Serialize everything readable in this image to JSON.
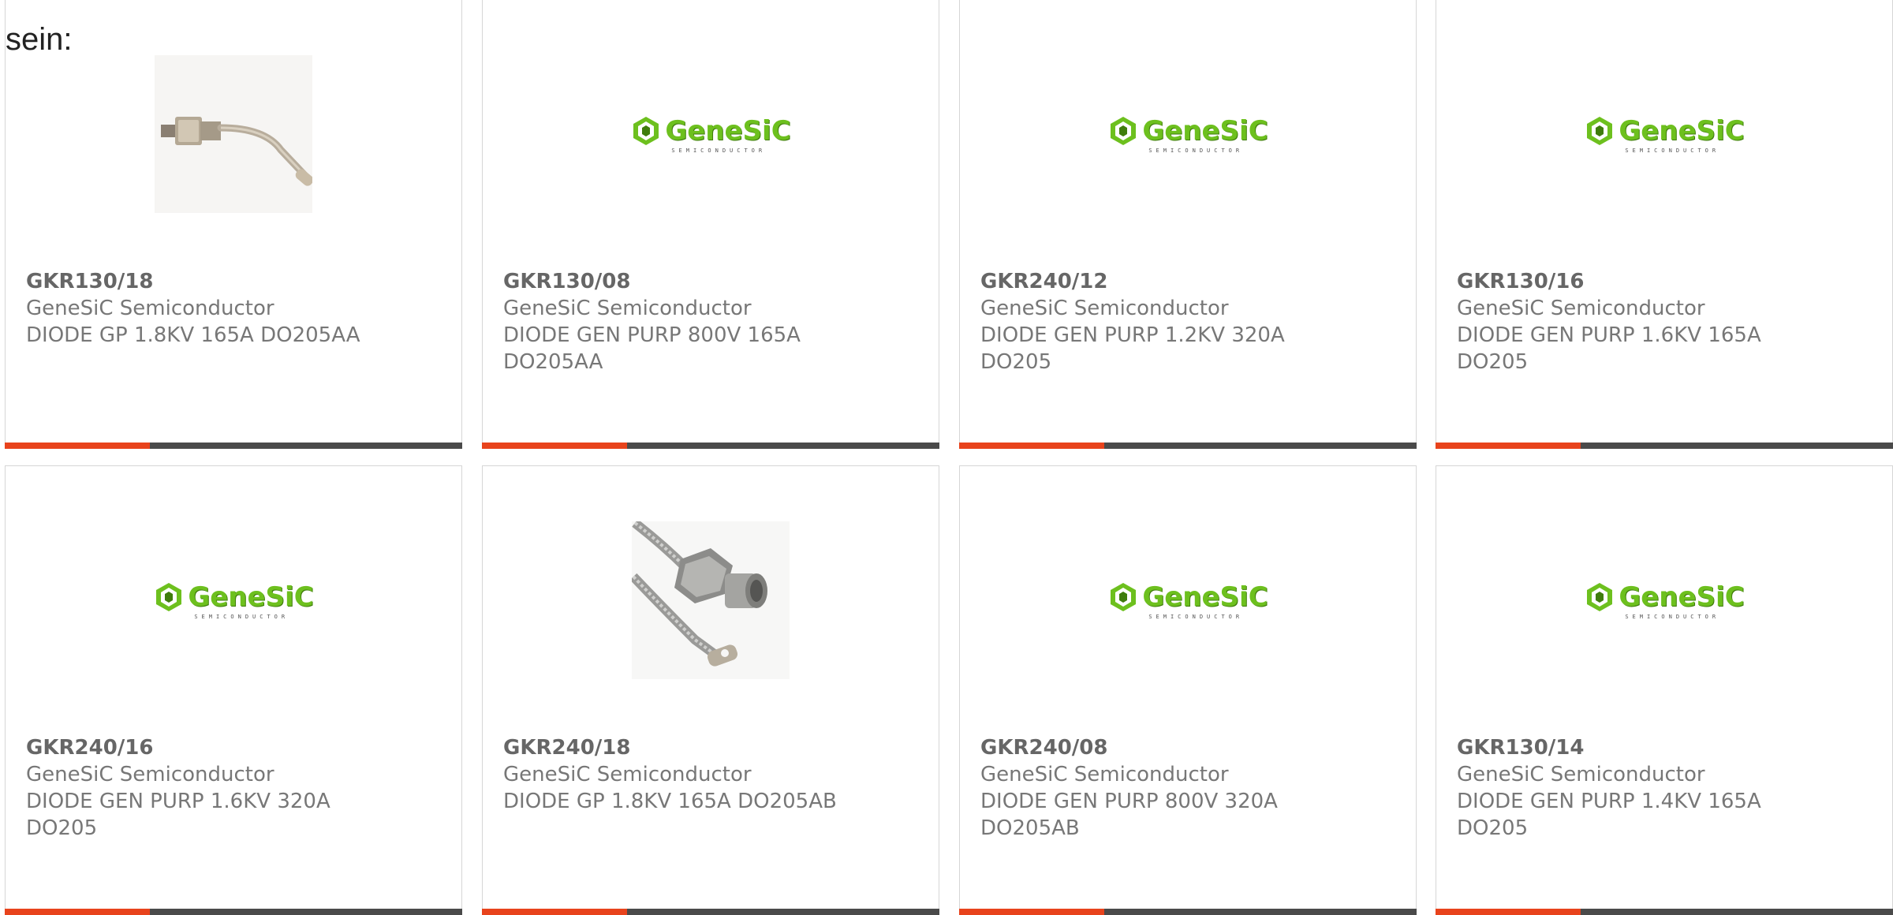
{
  "intro": {
    "text": "sein:"
  },
  "logo": {
    "word": "GeneSiC",
    "sub": "SEMICONDUCTOR"
  },
  "colors": {
    "accent": "#e8431c",
    "bar": "#4a4a4a",
    "logo_green": "#6dc01e"
  },
  "products": [
    {
      "part": "GKR130/18",
      "manufacturer": "GeneSiC Semiconductor",
      "desc1": "DIODE GP 1.8KV 165A DO205AA",
      "desc2": "",
      "image": "stud-diode-photo-bent"
    },
    {
      "part": "GKR130/08",
      "manufacturer": "GeneSiC Semiconductor",
      "desc1": "DIODE GEN PURP 800V 165A",
      "desc2": "DO205AA",
      "image": "genesic-logo"
    },
    {
      "part": "GKR240/12",
      "manufacturer": "GeneSiC Semiconductor",
      "desc1": "DIODE GEN PURP 1.2KV 320A",
      "desc2": "DO205",
      "image": "genesic-logo"
    },
    {
      "part": "GKR130/16",
      "manufacturer": "GeneSiC Semiconductor",
      "desc1": "DIODE GEN PURP 1.6KV 165A",
      "desc2": "DO205",
      "image": "genesic-logo"
    },
    {
      "part": "GKR240/16",
      "manufacturer": "GeneSiC Semiconductor",
      "desc1": "DIODE GEN PURP 1.6KV 320A",
      "desc2": "DO205",
      "image": "genesic-logo"
    },
    {
      "part": "GKR240/18",
      "manufacturer": "GeneSiC Semiconductor",
      "desc1": "DIODE GP 1.8KV 165A DO205AB",
      "desc2": "",
      "image": "stud-diode-photo-braided"
    },
    {
      "part": "GKR240/08",
      "manufacturer": "GeneSiC Semiconductor",
      "desc1": "DIODE GEN PURP 800V 320A",
      "desc2": "DO205AB",
      "image": "genesic-logo"
    },
    {
      "part": "GKR130/14",
      "manufacturer": "GeneSiC Semiconductor",
      "desc1": "DIODE GEN PURP 1.4KV 165A",
      "desc2": "DO205",
      "image": "genesic-logo"
    }
  ]
}
